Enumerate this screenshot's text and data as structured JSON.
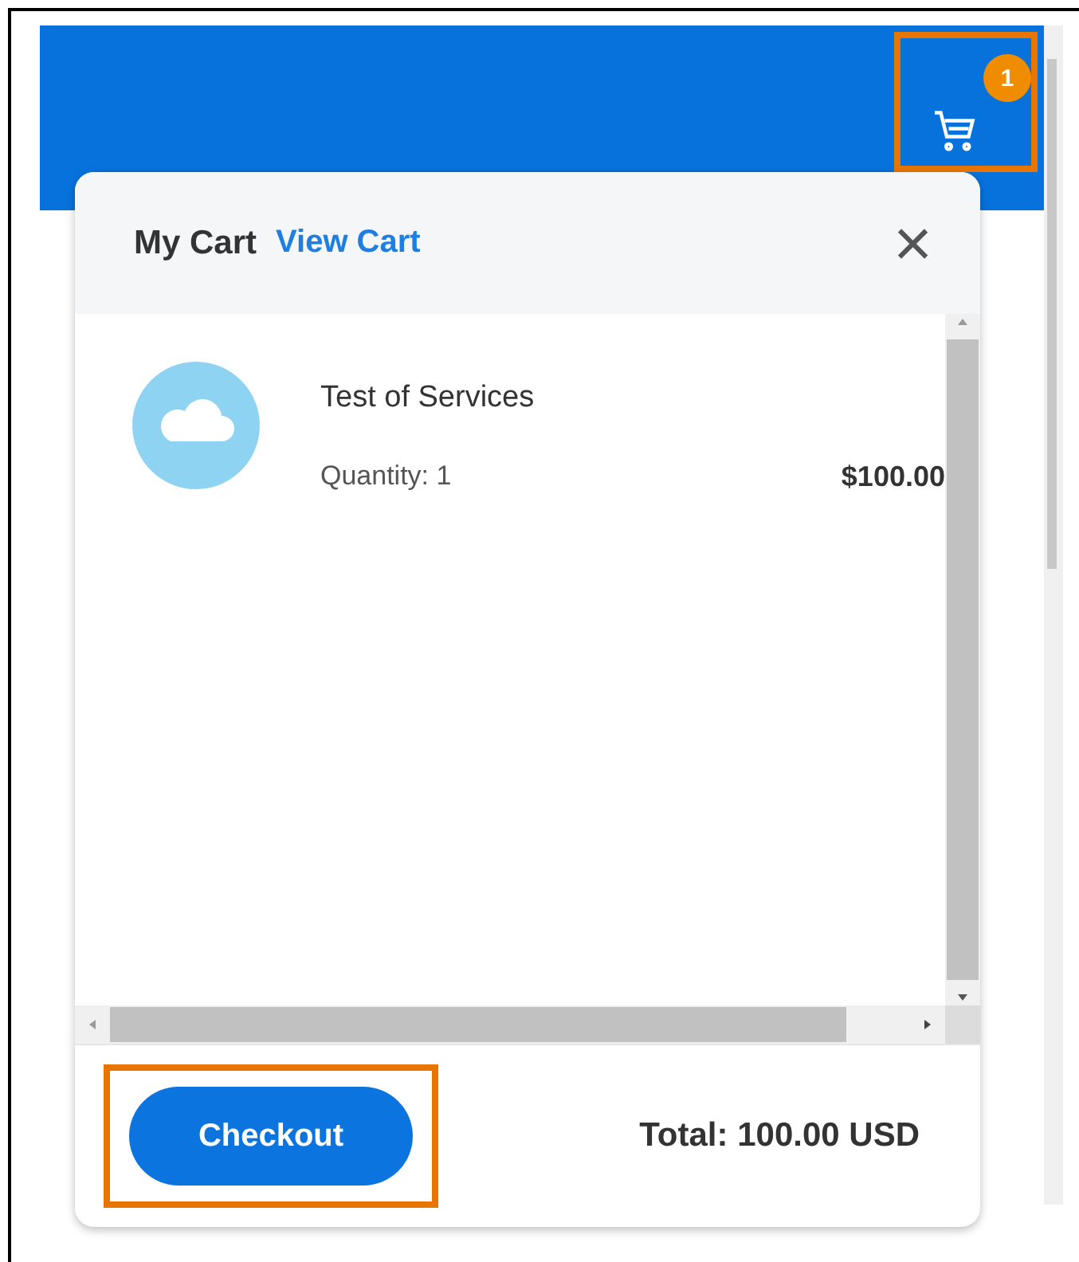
{
  "header": {
    "cart_count": "1",
    "cart_highlighted": true
  },
  "cart": {
    "title": "My Cart",
    "link": "View Cart",
    "close": "×",
    "items": [
      {
        "name": "Test of Services",
        "quantity": "Quantity: 1",
        "price": "$100.00"
      }
    ],
    "checkout": {
      "label": "Checkout",
      "highlighted": true
    },
    "total": "Total: 100.00 USD"
  }
}
